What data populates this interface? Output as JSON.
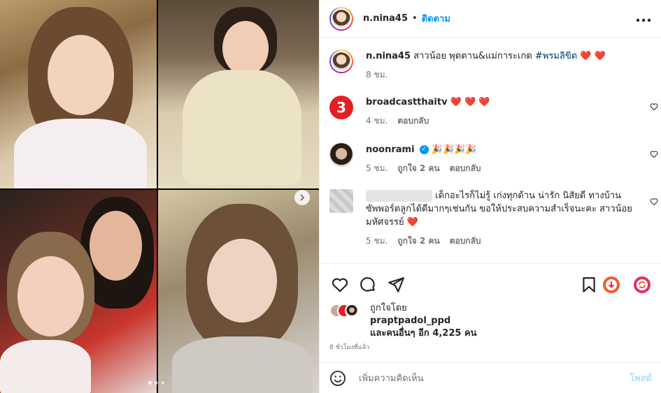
{
  "post": {
    "username": "n.nina45",
    "separator": "•",
    "follow_label": "ติดตาม",
    "more_icon": "more-horizontal-icon",
    "caption": "สาวน้อย พุดตาน&แม่การะเกด",
    "hashtag": "#พรมลิขิต",
    "caption_hearts": "❤️ ❤️",
    "caption_time": "8 ชม."
  },
  "comments": [
    {
      "username": "broadcastthaitv",
      "text": "❤️ ❤️ ❤️",
      "time": "4 ชม.",
      "reply": "ตอบกลับ"
    },
    {
      "username": "noonrami",
      "text": "🎉🎉🎉🎉",
      "time": "5 ชม.",
      "likes": "ถูกใจ 2 คน",
      "reply": "ตอบกลับ"
    },
    {
      "username": "",
      "text": "เด็กอะไรก็ไม่รู้ เก่งทุกด้าน น่ารัก นิสัยดี ทางบ้านซัพพอร์ตลูกได้ดีมากๆเช่นกัน ขอให้ประสบความสำเร็จนะคะ สาวน้อยมหัศจรรย์",
      "heart": "❤️",
      "time": "5 ชม.",
      "likes": "ถูกใจ 2 คน",
      "reply": "ตอบกลับ"
    }
  ],
  "likes": {
    "liked_by": "ถูกใจโดย",
    "user": "praptpadol_ppd",
    "others": "และคนอื่นๆ อีก 4,225 คน"
  },
  "time_ago": "8 ชั่วโมงที่แล้ว",
  "add_comment": {
    "placeholder": "เพิ่มความคิดเห็น",
    "post_label": "โพสต์"
  },
  "colors": {
    "accent": "#0095f6",
    "hashtag": "#00376b",
    "muted": "#737373",
    "heart": "#ed1c24",
    "post_disabled": "#b2dffc"
  },
  "carousel": {
    "total_slides": 5,
    "active_slide": 1
  }
}
